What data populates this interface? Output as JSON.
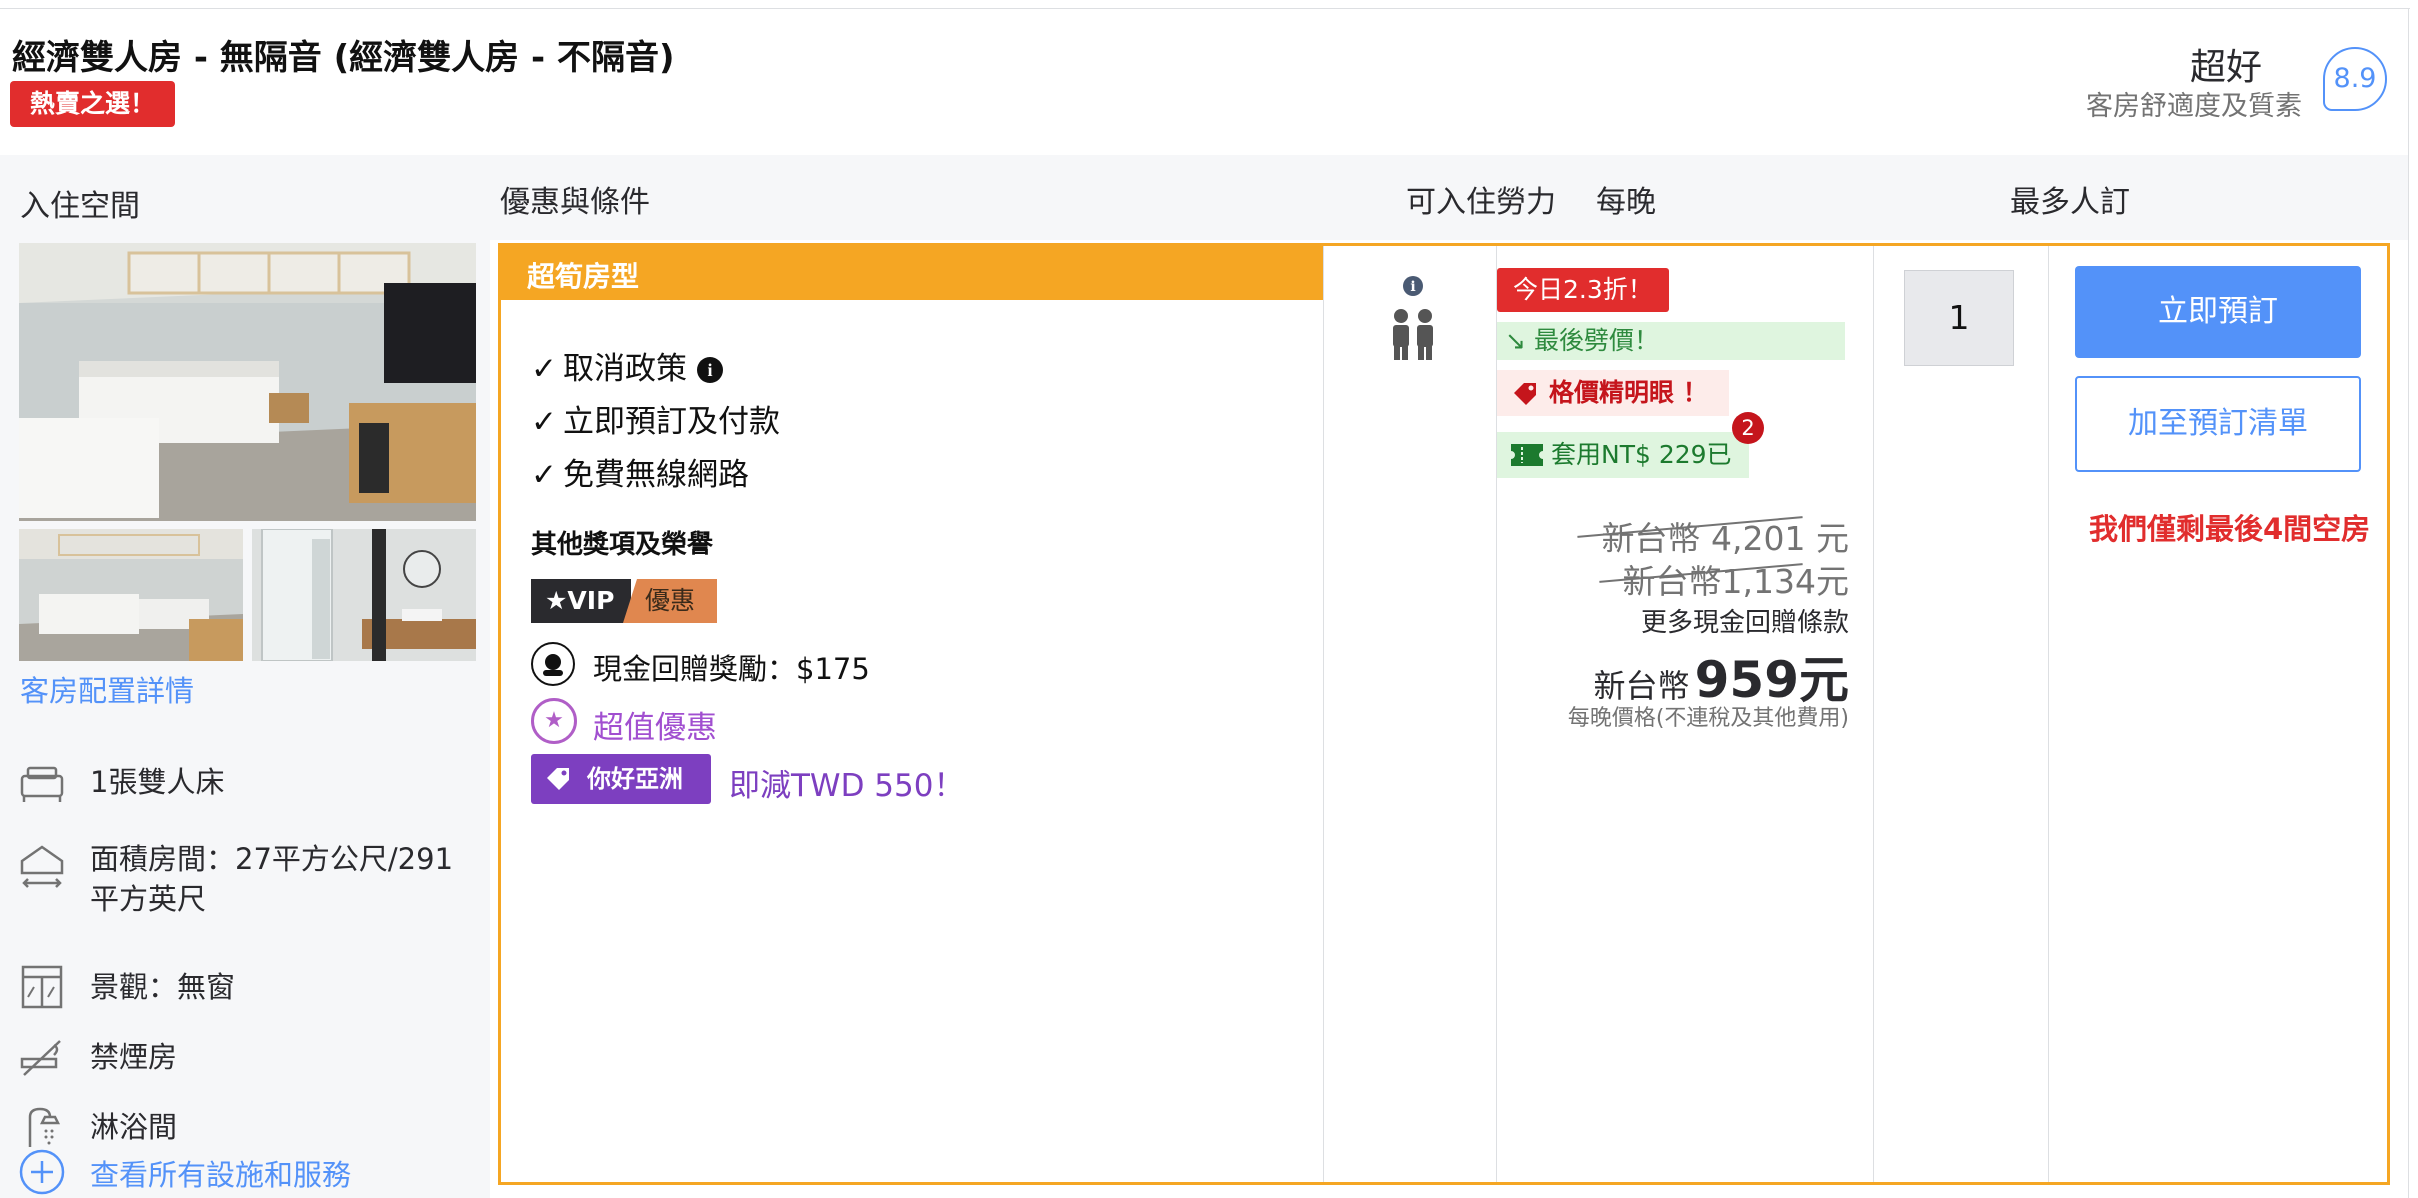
{
  "header": {
    "room_title": "經濟雙人房 - 無隔音 (經濟雙人房 - 不隔音)",
    "hot_badge": "熱賣之選！",
    "rating_word": "超好",
    "rating_sub": "客房舒適度及質素",
    "rating_score": "8.9"
  },
  "columns": {
    "room_space": "入住空間",
    "offers": "優惠與條件",
    "capacity": "可入住勞力",
    "per_night": "每晚",
    "max_book": "最多人訂"
  },
  "room": {
    "detail_link": "客房配置詳情",
    "amenities": [
      {
        "icon": "bed-icon",
        "label": "1張雙人床"
      },
      {
        "icon": "area-icon",
        "label": "面積房間：27平方公尺/291平方英尺"
      },
      {
        "icon": "window-icon",
        "label": "景觀：無窗"
      },
      {
        "icon": "no-smoking-icon",
        "label": "禁煙房"
      },
      {
        "icon": "shower-icon",
        "label": "淋浴間"
      }
    ],
    "see_all": "查看所有設施和服務"
  },
  "offer": {
    "band_label": "超筍房型",
    "checks": [
      "取消政策",
      "立即預訂及付款",
      "免費無線網路"
    ],
    "other_title": "其他獎項及榮譽",
    "vip_label": "VIP",
    "vip_sub": "優惠",
    "cash_reward": "現金回贈獎勵：$175",
    "super_deal": "超值優惠",
    "nihao_tag": "你好亞洲",
    "nihao_text": "即減TWD 550！"
  },
  "pricing": {
    "discount_badge": "今日2.3折！",
    "last_price": "最後劈價！",
    "smart_price": "格價精明眼 ！",
    "coupon": "套用NT$ 229已",
    "coupon_count": "2",
    "original_price": "新台幣 4,201 元",
    "crossed_price": "新台幣1,134元",
    "more_cash": "更多現金回贈條款",
    "final_currency": "新台幣",
    "final_amount": "959元",
    "per_night_note": "每晚價格(不連稅及其他費用)"
  },
  "booking": {
    "quantity": "1",
    "book_now": "立即預訂",
    "add_list": "加至預訂清單",
    "rooms_left": "我們僅剩最後4間空房"
  },
  "colors": {
    "accent_blue": "#5392f9",
    "orange": "#f5a623",
    "red": "#e12d2d",
    "purple": "#7d3fc0"
  }
}
